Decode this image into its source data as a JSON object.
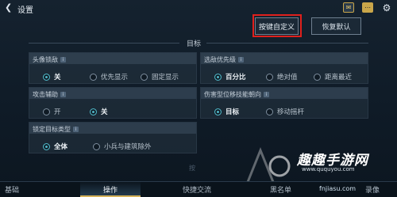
{
  "header": {
    "title": "设置",
    "icons": [
      "back-arrow-icon",
      "mail-icon",
      "chat-icon",
      "gear-icon"
    ]
  },
  "toolbar": {
    "custom_keys_label": "按键自定义",
    "reset_label": "恢复默认"
  },
  "section": {
    "title": "目标"
  },
  "panels": {
    "avatar_lock": {
      "title": "头像锁敌",
      "options": [
        "关",
        "优先显示",
        "固定显示"
      ],
      "selected": "关"
    },
    "target_priority": {
      "title": "选敌优先级",
      "options": [
        "百分比",
        "绝对值",
        "距离最近"
      ],
      "selected": "百分比"
    },
    "attack_assist": {
      "title": "攻击辅助",
      "options": [
        "开",
        "关"
      ],
      "selected": "关"
    },
    "skill_direction": {
      "title": "伤害型位移技能朝向",
      "options": [
        "目标",
        "移动摇杆"
      ],
      "selected": "目标"
    },
    "lock_target_type": {
      "title": "锁定目标类型",
      "options": [
        "全体",
        "小兵与建筑除外"
      ],
      "selected": "全体"
    }
  },
  "scroll_hint": "按",
  "tabs": [
    "基础",
    "操作",
    "快捷交流",
    "黑名单",
    "录像"
  ],
  "active_tab": "操作",
  "watermark": {
    "text": "趣趣手游网",
    "url": "www.ququyou.com",
    "url2": "fnjiasu.com"
  },
  "colors": {
    "accent": "#4fb6c6",
    "highlight": "#e0201c",
    "gold": "#d4b25a"
  }
}
